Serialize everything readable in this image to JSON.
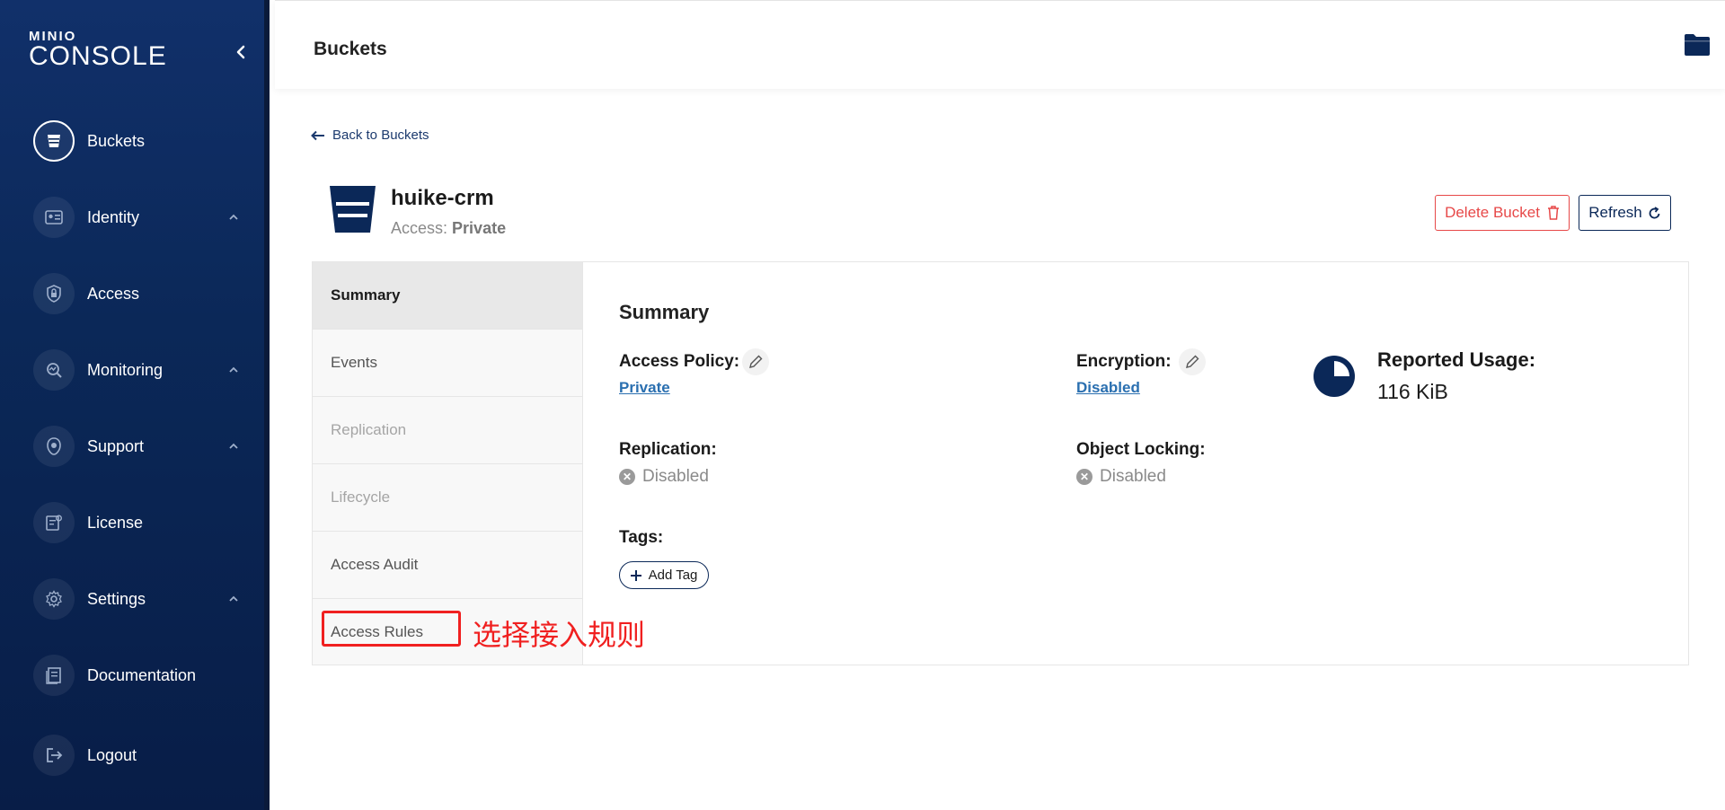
{
  "sidebar": {
    "logo_top": "MINIO",
    "logo_bottom": "CONSOLE",
    "items": [
      {
        "label": "Buckets",
        "icon": "bucket-icon"
      },
      {
        "label": "Identity",
        "icon": "id-card-icon"
      },
      {
        "label": "Access",
        "icon": "shield-lock-icon"
      },
      {
        "label": "Monitoring",
        "icon": "monitor-search-icon"
      },
      {
        "label": "Support",
        "icon": "support-icon"
      },
      {
        "label": "License",
        "icon": "license-icon"
      },
      {
        "label": "Settings",
        "icon": "gear-icon"
      },
      {
        "label": "Documentation",
        "icon": "docs-icon"
      },
      {
        "label": "Logout",
        "icon": "logout-icon"
      }
    ]
  },
  "header": {
    "title": "Buckets"
  },
  "main": {
    "back_label": "Back to Buckets",
    "bucket_name": "huike-crm",
    "access_prefix": "Access:",
    "access_value": "Private",
    "delete_label": "Delete Bucket",
    "refresh_label": "Refresh",
    "tabs": [
      {
        "label": "Summary",
        "state": "active"
      },
      {
        "label": "Events",
        "state": "normal"
      },
      {
        "label": "Replication",
        "state": "disabled"
      },
      {
        "label": "Lifecycle",
        "state": "disabled"
      },
      {
        "label": "Access Audit",
        "state": "normal"
      },
      {
        "label": "Access Rules",
        "state": "normal"
      }
    ],
    "annotation": "选择接入规则",
    "summary": {
      "title": "Summary",
      "access_policy_label": "Access Policy:",
      "access_policy_value": "Private",
      "encryption_label": "Encryption:",
      "encryption_value": "Disabled",
      "reported_usage_label": "Reported Usage:",
      "reported_usage_value": "116 KiB",
      "replication_label": "Replication:",
      "replication_value": "Disabled",
      "object_locking_label": "Object Locking:",
      "object_locking_value": "Disabled",
      "tags_label": "Tags:",
      "add_tag_label": "Add Tag"
    }
  },
  "colors": {
    "sidebar_bg": "#0b2858",
    "accent_navy": "#0b2858",
    "danger": "#e74848",
    "link": "#2a6fb0",
    "annotation_red": "#f02020"
  }
}
